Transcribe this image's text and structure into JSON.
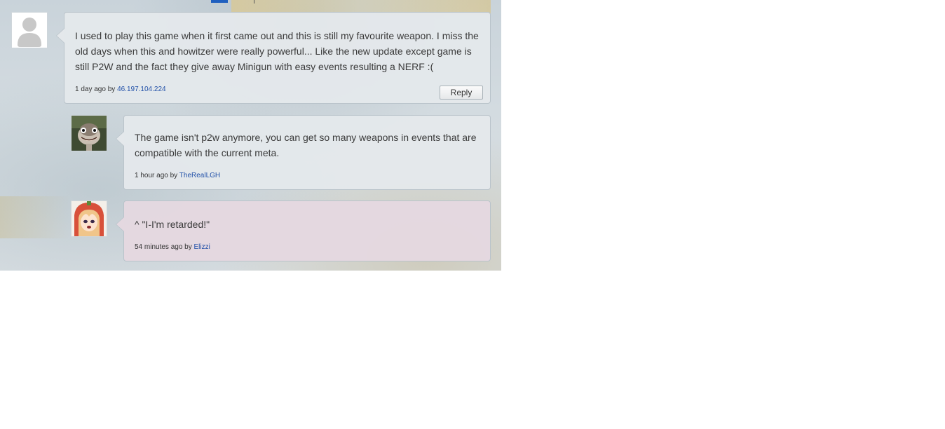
{
  "comments": [
    {
      "text": "I used to play this game when it first came out and this is still my favourite weapon. I miss the old days when this and howitzer were really powerful... Like the new update except game is still P2W and the fact they give away Minigun with easy events resulting a NERF :(",
      "time": "1 day ago",
      "by_label": "by",
      "author": "46.197.104.224",
      "reply_label": "Reply",
      "avatar": "default-user-avatar"
    },
    {
      "text": "The game isn't p2w anymore, you can get so many weapons in events that are compatible with the current meta.",
      "time": "1 hour ago",
      "by_label": "by",
      "author": "TheRealLGH",
      "avatar": "ostrich-avatar"
    },
    {
      "text": "^ \"I-I'm retarded!\"",
      "time": "54 minutes ago",
      "by_label": "by",
      "author": "Elizzi",
      "avatar": "anime-girl-avatar"
    }
  ],
  "colors": {
    "link": "#2150a8",
    "bubble": "#e4e8eb",
    "bubble_highlight": "#e4d8e0"
  }
}
